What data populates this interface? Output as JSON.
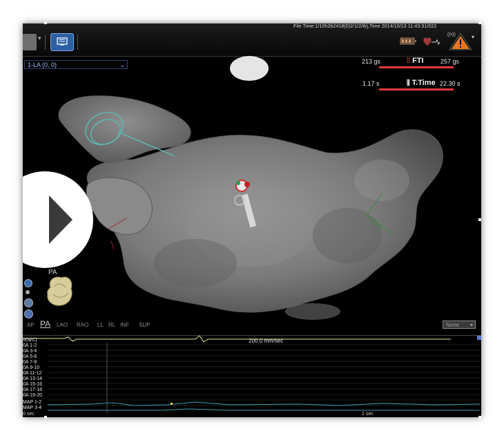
{
  "status_bar": {
    "file_time": "File Time:1/10h2b2418(0)2/1/2/8/j,Time 2014/10/13 11:43:31/022"
  },
  "map": {
    "dropdown_label": "1-LA (0, 0)"
  },
  "metrics": {
    "fti": {
      "left_value": "213 gs",
      "label": "FTI",
      "right_value": "257 gs"
    },
    "t_time": {
      "left_value": "1.17 s",
      "label": "T.Time",
      "right_value": "22.30 s"
    }
  },
  "orientation": {
    "thumbnail_label": "PA"
  },
  "view_tabs": [
    {
      "label": "AP",
      "active": false
    },
    {
      "label": "PA",
      "active": true
    },
    {
      "label": "LAO",
      "active": false
    },
    {
      "label": "RAO",
      "active": false
    },
    {
      "label": "LL",
      "active": false
    },
    {
      "label": "RL",
      "active": false
    },
    {
      "label": "INF",
      "active": false
    },
    {
      "label": "SUP",
      "active": false
    }
  ],
  "overlay_select": {
    "value": "None"
  },
  "ecg": {
    "sweep_speed": "200.0 mm/sec",
    "leads": [
      "II(N/C)",
      "0A 1-2",
      "0A 3-4",
      "0A 5-6",
      "0A 7-8",
      "0A 9-10",
      "0A 11-12",
      "0A 13-14",
      "0A 15-16",
      "0A 17-18",
      "0A 19-20",
      "MAP 1-2",
      "MAP 3-4"
    ],
    "time_start": "0 sec",
    "time_mid": "1 sec"
  },
  "colors": {
    "accent_blue": "#2d5fa3",
    "metric_bar": "#e23a3a",
    "ecg_trace": "#e8e6a0",
    "map_trace": "#3aa0b8"
  },
  "icons": [
    "settings-icon",
    "screen-icon",
    "battery-icon",
    "heart-icon",
    "warning-icon",
    "play-icon"
  ]
}
